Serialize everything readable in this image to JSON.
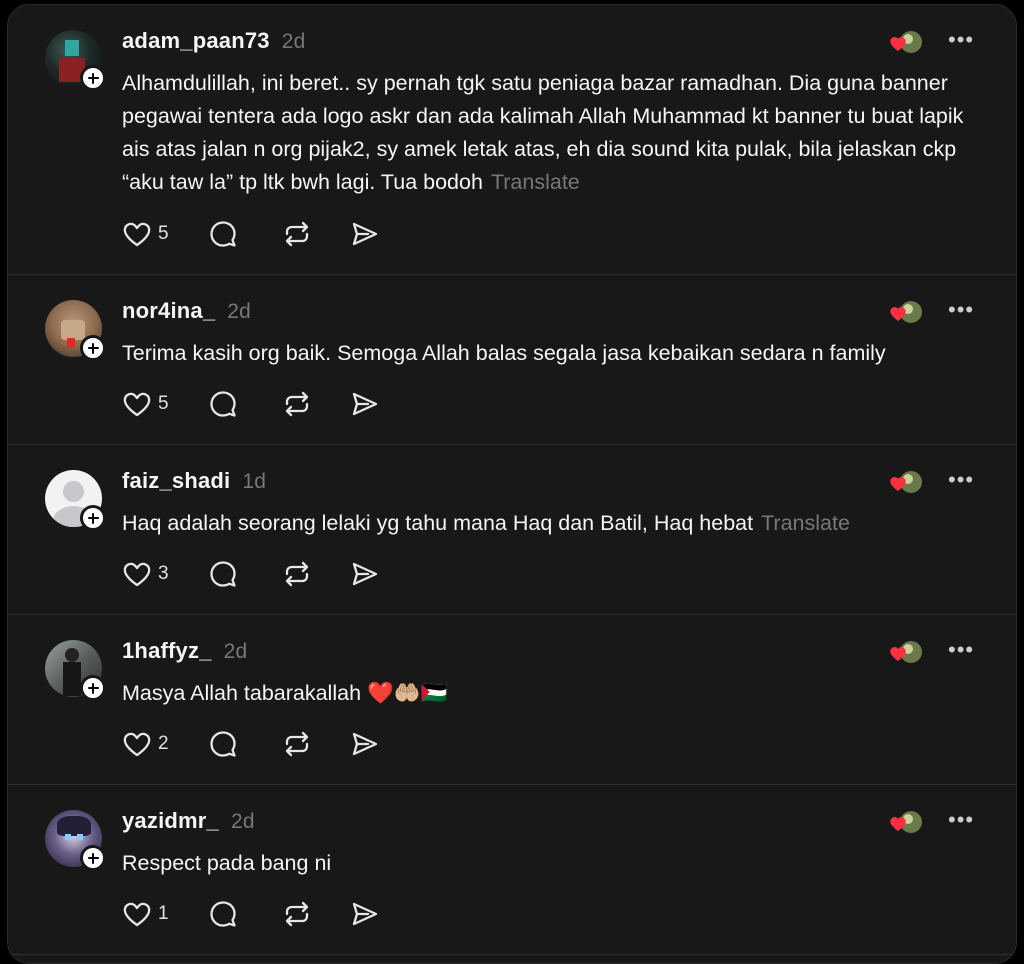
{
  "comments": [
    {
      "username": "adam_paan73",
      "time": "2d",
      "text": "Alhamdulillah, ini beret.. sy pernah tgk satu peniaga bazar ramadhan. Dia guna banner pegawai tentera ada logo askr dan ada kalimah Allah Muhammad kt banner tu buat lapik ais atas jalan n org pijak2, sy amek letak atas, eh dia sound kita pulak, bila jelaskan ckp “aku taw la” tp ltk bwh lagi. Tua bodoh",
      "translate": "Translate",
      "likes": "5"
    },
    {
      "username": "nor4ina_",
      "time": "2d",
      "text": "Terima kasih org baik. Semoga Allah balas segala jasa kebaikan sedara n family",
      "translate": "",
      "likes": "5"
    },
    {
      "username": "faiz_shadi",
      "time": "1d",
      "text": "Haq adalah seorang lelaki yg tahu mana Haq dan Batil, Haq hebat",
      "translate": "Translate",
      "likes": "3"
    },
    {
      "username": "1haffyz_",
      "time": "2d",
      "text": "Masya Allah tabarakallah ❤️🤲🏼🇵🇸",
      "translate": "",
      "likes": "2"
    },
    {
      "username": "yazidmr_",
      "time": "2d",
      "text": "Respect pada bang ni",
      "translate": "",
      "likes": "1"
    }
  ],
  "more_label": "•••",
  "icons": {
    "like": "heart-outline-icon",
    "reply": "comment-bubble-icon",
    "repost": "repost-icon",
    "share": "send-icon",
    "liked_by_author": "author-liked-heart-icon"
  },
  "colors": {
    "background": "#181818",
    "text": "#f3f5f7",
    "muted": "#777777",
    "heart": "#ff3040"
  }
}
